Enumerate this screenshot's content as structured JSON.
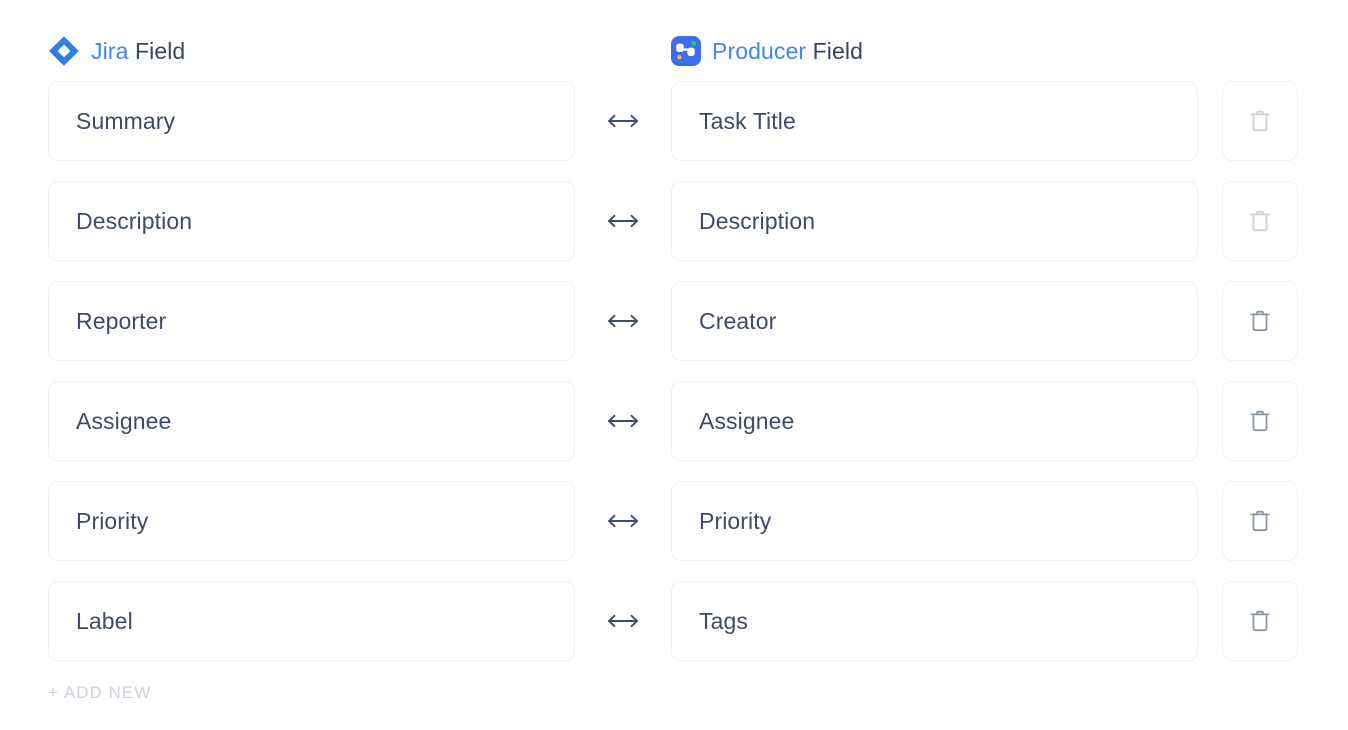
{
  "columns": {
    "left": {
      "brand": "Jira",
      "suffix": " Field",
      "icon": "jira-diamond-icon"
    },
    "right": {
      "brand": "Producer",
      "suffix": " Field",
      "icon": "producer-app-icon"
    }
  },
  "link_icon": "left-right-arrow-icon",
  "delete_icon": "trash-icon",
  "mappings": [
    {
      "left": "Summary",
      "right": "Task Title",
      "delete_enabled": false
    },
    {
      "left": "Description",
      "right": "Description",
      "delete_enabled": false
    },
    {
      "left": "Reporter",
      "right": "Creator",
      "delete_enabled": true
    },
    {
      "left": "Assignee",
      "right": "Assignee",
      "delete_enabled": true
    },
    {
      "left": "Priority",
      "right": "Priority",
      "delete_enabled": true
    },
    {
      "left": "Label",
      "right": "Tags",
      "delete_enabled": true
    }
  ],
  "add_new": {
    "label": "+ ADD NEW"
  },
  "colors": {
    "brand_blue": "#4285f4",
    "producer_blue": "#3b6ef0",
    "text_dark": "#3f4b66",
    "border": "#f1f1f4",
    "trash_active": "#8b96ad",
    "trash_disabled": "#ccd0da",
    "add_new": "#ccd1dd"
  }
}
